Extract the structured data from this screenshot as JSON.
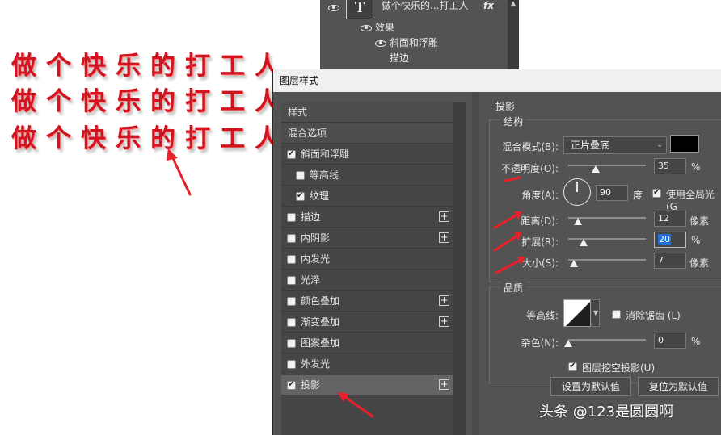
{
  "canvas": {
    "lines": [
      "做个快乐的打工人",
      "做个快乐的打工人",
      "做个快乐的打工人"
    ],
    "text_color": "#d01520"
  },
  "layers": {
    "layer_name": "做个快乐的...打工人",
    "thumb_icon": "T",
    "fx_label": "fx",
    "effects_label": "效果",
    "bevel_label": "斜面和浮雕",
    "stroke_label": "描边"
  },
  "dialog": {
    "title": "图层样式",
    "styles": [
      {
        "label": "样式",
        "type": "header"
      },
      {
        "label": "混合选项",
        "type": "header"
      },
      {
        "label": "斜面和浮雕",
        "checked": true
      },
      {
        "label": "等高线",
        "checked": false,
        "indent": true
      },
      {
        "label": "纹理",
        "checked": true,
        "indent": true
      },
      {
        "label": "描边",
        "checked": false,
        "plus": true
      },
      {
        "label": "内阴影",
        "checked": false,
        "plus": true
      },
      {
        "label": "内发光",
        "checked": false
      },
      {
        "label": "光泽",
        "checked": false
      },
      {
        "label": "颜色叠加",
        "checked": false,
        "plus": true
      },
      {
        "label": "渐变叠加",
        "checked": false,
        "plus": true
      },
      {
        "label": "图案叠加",
        "checked": false
      },
      {
        "label": "外发光",
        "checked": false
      },
      {
        "label": "投影",
        "checked": true,
        "plus": true,
        "selected": true
      }
    ],
    "shadow": {
      "section_title": "投影",
      "structure_title": "结构",
      "blend_mode_label": "混合模式(B):",
      "blend_mode_value": "正片叠底",
      "blend_color": "#000000",
      "opacity_label": "不透明度(O):",
      "opacity_value": "35",
      "opacity_unit": "%",
      "angle_label": "角度(A):",
      "angle_value": "90",
      "angle_unit": "度",
      "global_light_label": "使用全局光 (G",
      "global_light_checked": true,
      "distance_label": "距离(D):",
      "distance_value": "12",
      "distance_unit": "像素",
      "spread_label": "扩展(R):",
      "spread_value": "20",
      "spread_unit": "%",
      "size_label": "大小(S):",
      "size_value": "7",
      "size_unit": "像素",
      "quality_title": "品质",
      "contour_label": "等高线:",
      "antialias_label": "消除锯齿 (L)",
      "antialias_checked": false,
      "noise_label": "杂色(N):",
      "noise_value": "0",
      "noise_unit": "%",
      "knockout_label": "图层挖空投影(U)",
      "knockout_checked": true,
      "set_default_label": "设置为默认值",
      "reset_default_label": "复位为默认值"
    }
  },
  "slider_levels": {
    "opacity": 0.35,
    "distance": 0.12,
    "spread": 0.2,
    "size": 0.07,
    "noise": 0
  },
  "annotations": {
    "arrow_color": "#e8202a"
  },
  "watermark": "头条 @123是圆圆啊"
}
